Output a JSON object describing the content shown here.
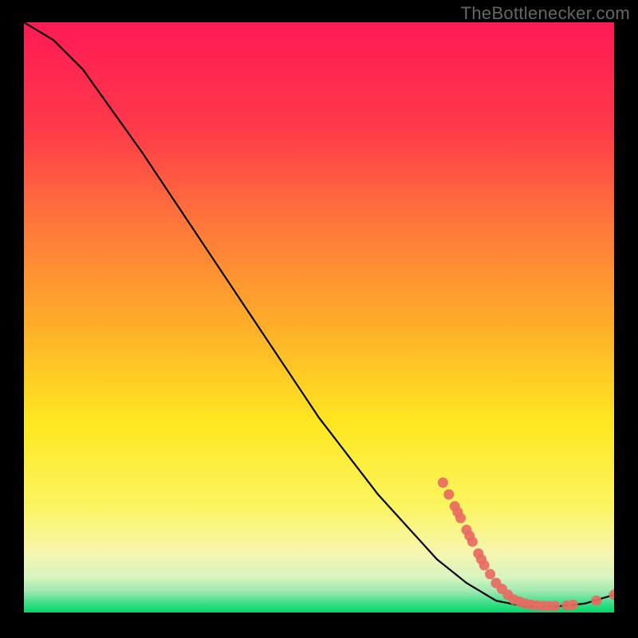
{
  "watermark": "TheBottlenecker.com",
  "chart_data": {
    "type": "line",
    "title": "",
    "xlabel": "",
    "ylabel": "",
    "xlim": [
      0,
      100
    ],
    "ylim": [
      0,
      100
    ],
    "curve": [
      {
        "x": 0,
        "y": 100
      },
      {
        "x": 5,
        "y": 97
      },
      {
        "x": 10,
        "y": 92
      },
      {
        "x": 20,
        "y": 78
      },
      {
        "x": 30,
        "y": 63
      },
      {
        "x": 40,
        "y": 48
      },
      {
        "x": 50,
        "y": 33
      },
      {
        "x": 60,
        "y": 20
      },
      {
        "x": 70,
        "y": 9
      },
      {
        "x": 75,
        "y": 5
      },
      {
        "x": 80,
        "y": 2
      },
      {
        "x": 85,
        "y": 1
      },
      {
        "x": 90,
        "y": 1
      },
      {
        "x": 95,
        "y": 1.5
      },
      {
        "x": 100,
        "y": 3
      }
    ],
    "scatter": [
      {
        "x": 71,
        "y": 22
      },
      {
        "x": 72,
        "y": 20
      },
      {
        "x": 73,
        "y": 18
      },
      {
        "x": 73.5,
        "y": 17
      },
      {
        "x": 74,
        "y": 16
      },
      {
        "x": 75,
        "y": 14
      },
      {
        "x": 75.5,
        "y": 13
      },
      {
        "x": 76,
        "y": 12
      },
      {
        "x": 77,
        "y": 10
      },
      {
        "x": 77.5,
        "y": 9
      },
      {
        "x": 78,
        "y": 8
      },
      {
        "x": 79,
        "y": 6.5
      },
      {
        "x": 80,
        "y": 5
      },
      {
        "x": 81,
        "y": 4
      },
      {
        "x": 82,
        "y": 3
      },
      {
        "x": 83,
        "y": 2.2
      },
      {
        "x": 84,
        "y": 1.8
      },
      {
        "x": 85,
        "y": 1.5
      },
      {
        "x": 86,
        "y": 1.3
      },
      {
        "x": 87,
        "y": 1.2
      },
      {
        "x": 88,
        "y": 1.1
      },
      {
        "x": 89,
        "y": 1.1
      },
      {
        "x": 90,
        "y": 1.1
      },
      {
        "x": 92,
        "y": 1.2
      },
      {
        "x": 93,
        "y": 1.3
      },
      {
        "x": 97,
        "y": 2
      },
      {
        "x": 100,
        "y": 3
      }
    ],
    "gradient_bands": [
      {
        "from": 100,
        "to": 98,
        "color": "#ff1a54"
      },
      {
        "from": 98,
        "to": 75,
        "color_from": "#ff1a54",
        "color_to": "#ff6040"
      },
      {
        "from": 75,
        "to": 50,
        "color_from": "#ff6040",
        "color_to": "#ffb030"
      },
      {
        "from": 50,
        "to": 28,
        "color_from": "#ffb030",
        "color_to": "#ffe820"
      },
      {
        "from": 28,
        "to": 12,
        "color_from": "#ffe820",
        "color_to": "#fbf88a"
      },
      {
        "from": 12,
        "to": 7,
        "color_from": "#fbf88a",
        "color_to": "#e8f7b0"
      },
      {
        "from": 7,
        "to": 4,
        "color_from": "#e8f7b0",
        "color_to": "#a0efb0"
      },
      {
        "from": 4,
        "to": 0,
        "color_from": "#a0efb0",
        "color_to": "#00e070"
      }
    ]
  }
}
